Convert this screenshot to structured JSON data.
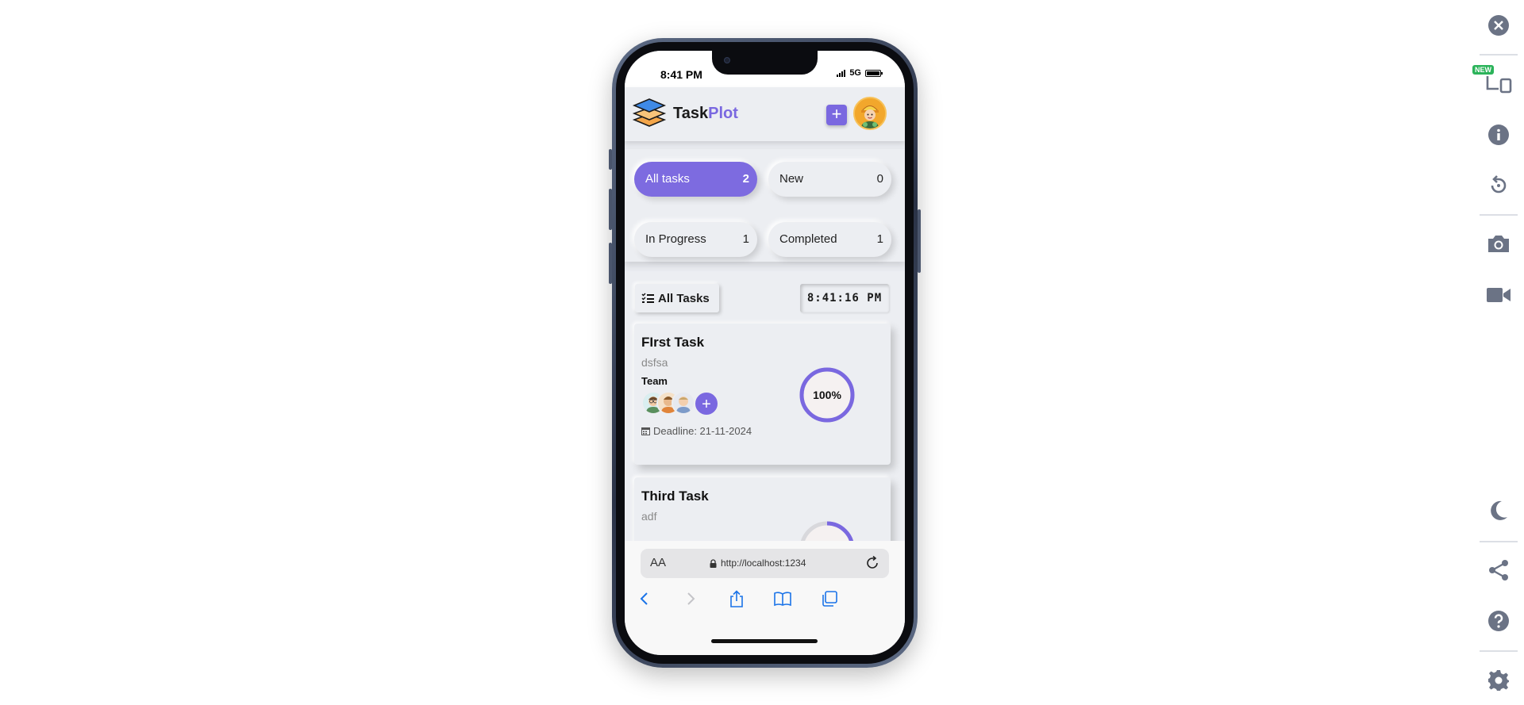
{
  "status_bar": {
    "time": "8:41 PM",
    "network": "5G"
  },
  "app": {
    "brand_primary": "Task",
    "brand_accent": "Plot",
    "accent_color": "#7a68e0",
    "add_button_label": "+"
  },
  "filters": [
    {
      "label": "All tasks",
      "count": "2",
      "active": true
    },
    {
      "label": "New",
      "count": "0",
      "active": false
    },
    {
      "label": "In Progress",
      "count": "1",
      "active": false
    },
    {
      "label": "Completed",
      "count": "1",
      "active": false
    }
  ],
  "tasks_section": {
    "title": "All Tasks",
    "clock": "8:41:16 PM"
  },
  "tasks": [
    {
      "title": "FIrst Task",
      "description": "dsfsa",
      "team_label": "Team",
      "add_member_label": "+",
      "deadline": "Deadline: 21-11-2024",
      "progress_label": "100%",
      "progress": 1.0
    },
    {
      "title": "Third Task",
      "description": "adf",
      "progress": 0.5
    }
  ],
  "browser": {
    "text_size_label": "AA",
    "url": "http://localhost:1234"
  },
  "toolbar": {
    "new_badge": "NEW"
  },
  "icons": [
    "close-icon",
    "devices-icon",
    "info-icon",
    "rotate-icon",
    "camera-icon",
    "video-icon",
    "moon-icon",
    "share-icon",
    "help-icon",
    "settings-icon"
  ]
}
